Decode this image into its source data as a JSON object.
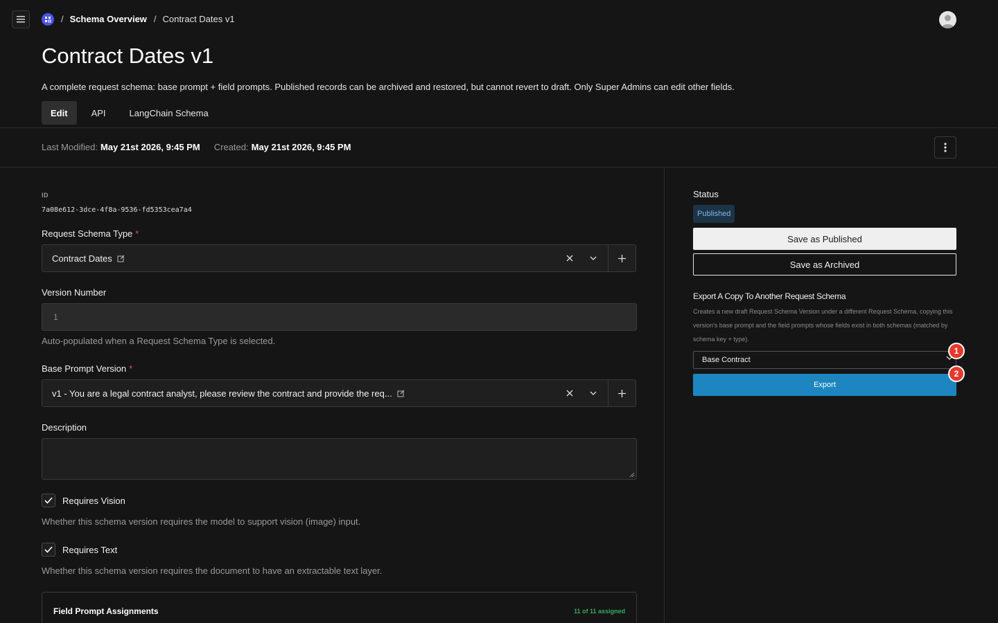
{
  "header": {
    "logo_icon": "grid-logo-icon",
    "breadcrumb": {
      "separator": "/",
      "items": [
        "Schema Overview",
        "Contract Dates v1"
      ]
    }
  },
  "page": {
    "title": "Contract Dates v1",
    "description": "A complete request schema: base prompt + field prompts. Published records can be archived and restored, but cannot revert to draft. Only Super Admins can edit other fields.",
    "tabs": [
      {
        "label": "Edit",
        "active": true
      },
      {
        "label": "API",
        "active": false
      },
      {
        "label": "LangChain Schema",
        "active": false
      }
    ]
  },
  "meta": {
    "last_modified_label": "Last Modified:",
    "last_modified_value": "May 21st 2026, 9:45 PM",
    "created_label": "Created:",
    "created_value": "May 21st 2026, 9:45 PM"
  },
  "form": {
    "id_label": "ID",
    "id_value": "7a08e612-3dce-4f8a-9536-fd5353cea7a4",
    "schema_type": {
      "label": "Request Schema Type",
      "required": "*",
      "value": "Contract Dates"
    },
    "version_number": {
      "label": "Version Number",
      "value": "1",
      "hint": "Auto-populated when a Request Schema Type is selected."
    },
    "base_prompt": {
      "label": "Base Prompt Version",
      "required": "*",
      "value": "v1 - You are a legal contract analyst, please review the contract and provide the req..."
    },
    "description": {
      "label": "Description",
      "value": ""
    },
    "requires_vision": {
      "label": "Requires Vision",
      "checked": true,
      "hint": "Whether this schema version requires the model to support vision (image) input."
    },
    "requires_text": {
      "label": "Requires Text",
      "checked": true,
      "hint": "Whether this schema version requires the document to have an extractable text layer."
    },
    "field_prompts": {
      "title": "Field Prompt Assignments",
      "count": "11 of 11 assigned"
    }
  },
  "sidebar": {
    "status_label": "Status",
    "status_value": "Published",
    "save_published": "Save as Published",
    "save_archived": "Save as Archived",
    "export_title": "Export A Copy To Another Request Schema",
    "export_desc": "Creates a new draft Request Schema Version under a different Request Schema, copying this version's base prompt and the field prompts whose fields exist in both schemas (matched by schema key + type).",
    "export_select_value": "Base Contract",
    "export_button": "Export",
    "markers": [
      "1",
      "2"
    ]
  },
  "colors": {
    "background": "#151515",
    "accent": "#1d86c0",
    "badge_bg": "#1d3346",
    "success": "#39a860",
    "marker": "#e5392c"
  }
}
